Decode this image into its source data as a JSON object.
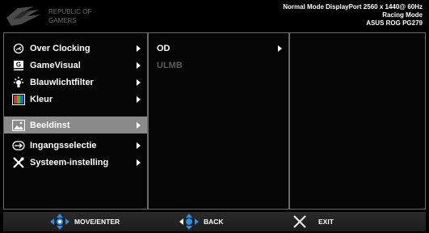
{
  "header": {
    "logo_text": [
      "REPUBLIC OF",
      "GAMERS"
    ],
    "status_lines": [
      "Normal Mode DisplayPort 2560 x 1440@ 60Hz",
      "Racing Mode",
      "ASUS ROG PG279"
    ]
  },
  "main_menu": {
    "items": [
      {
        "label": "Over Clocking",
        "icon": "speedometer-icon"
      },
      {
        "label": "GameVisual",
        "icon": "gamevisual-icon"
      },
      {
        "label": "Blauwlichtfilter",
        "icon": "lightbulb-icon"
      },
      {
        "label": "Kleur",
        "icon": "color-palette-icon"
      },
      {
        "label": "Beeldinst",
        "icon": "image-icon",
        "selected": true
      },
      {
        "label": "Ingangsselectie",
        "icon": "input-source-icon"
      },
      {
        "label": "Systeem-instelling",
        "icon": "tools-icon"
      }
    ]
  },
  "sub_menu": {
    "items": [
      {
        "label": "OD",
        "enabled": true
      },
      {
        "label": "ULMB",
        "enabled": false
      }
    ]
  },
  "footer": {
    "move_label": "MOVE/ENTER",
    "back_label": "BACK",
    "exit_label": "EXIT"
  },
  "colors": {
    "selected_bg": "#8a8a8a",
    "accent_blue": "#2d8fe0",
    "exit_x": "#e6e6e6",
    "disabled_text": "#5c5c5c"
  }
}
